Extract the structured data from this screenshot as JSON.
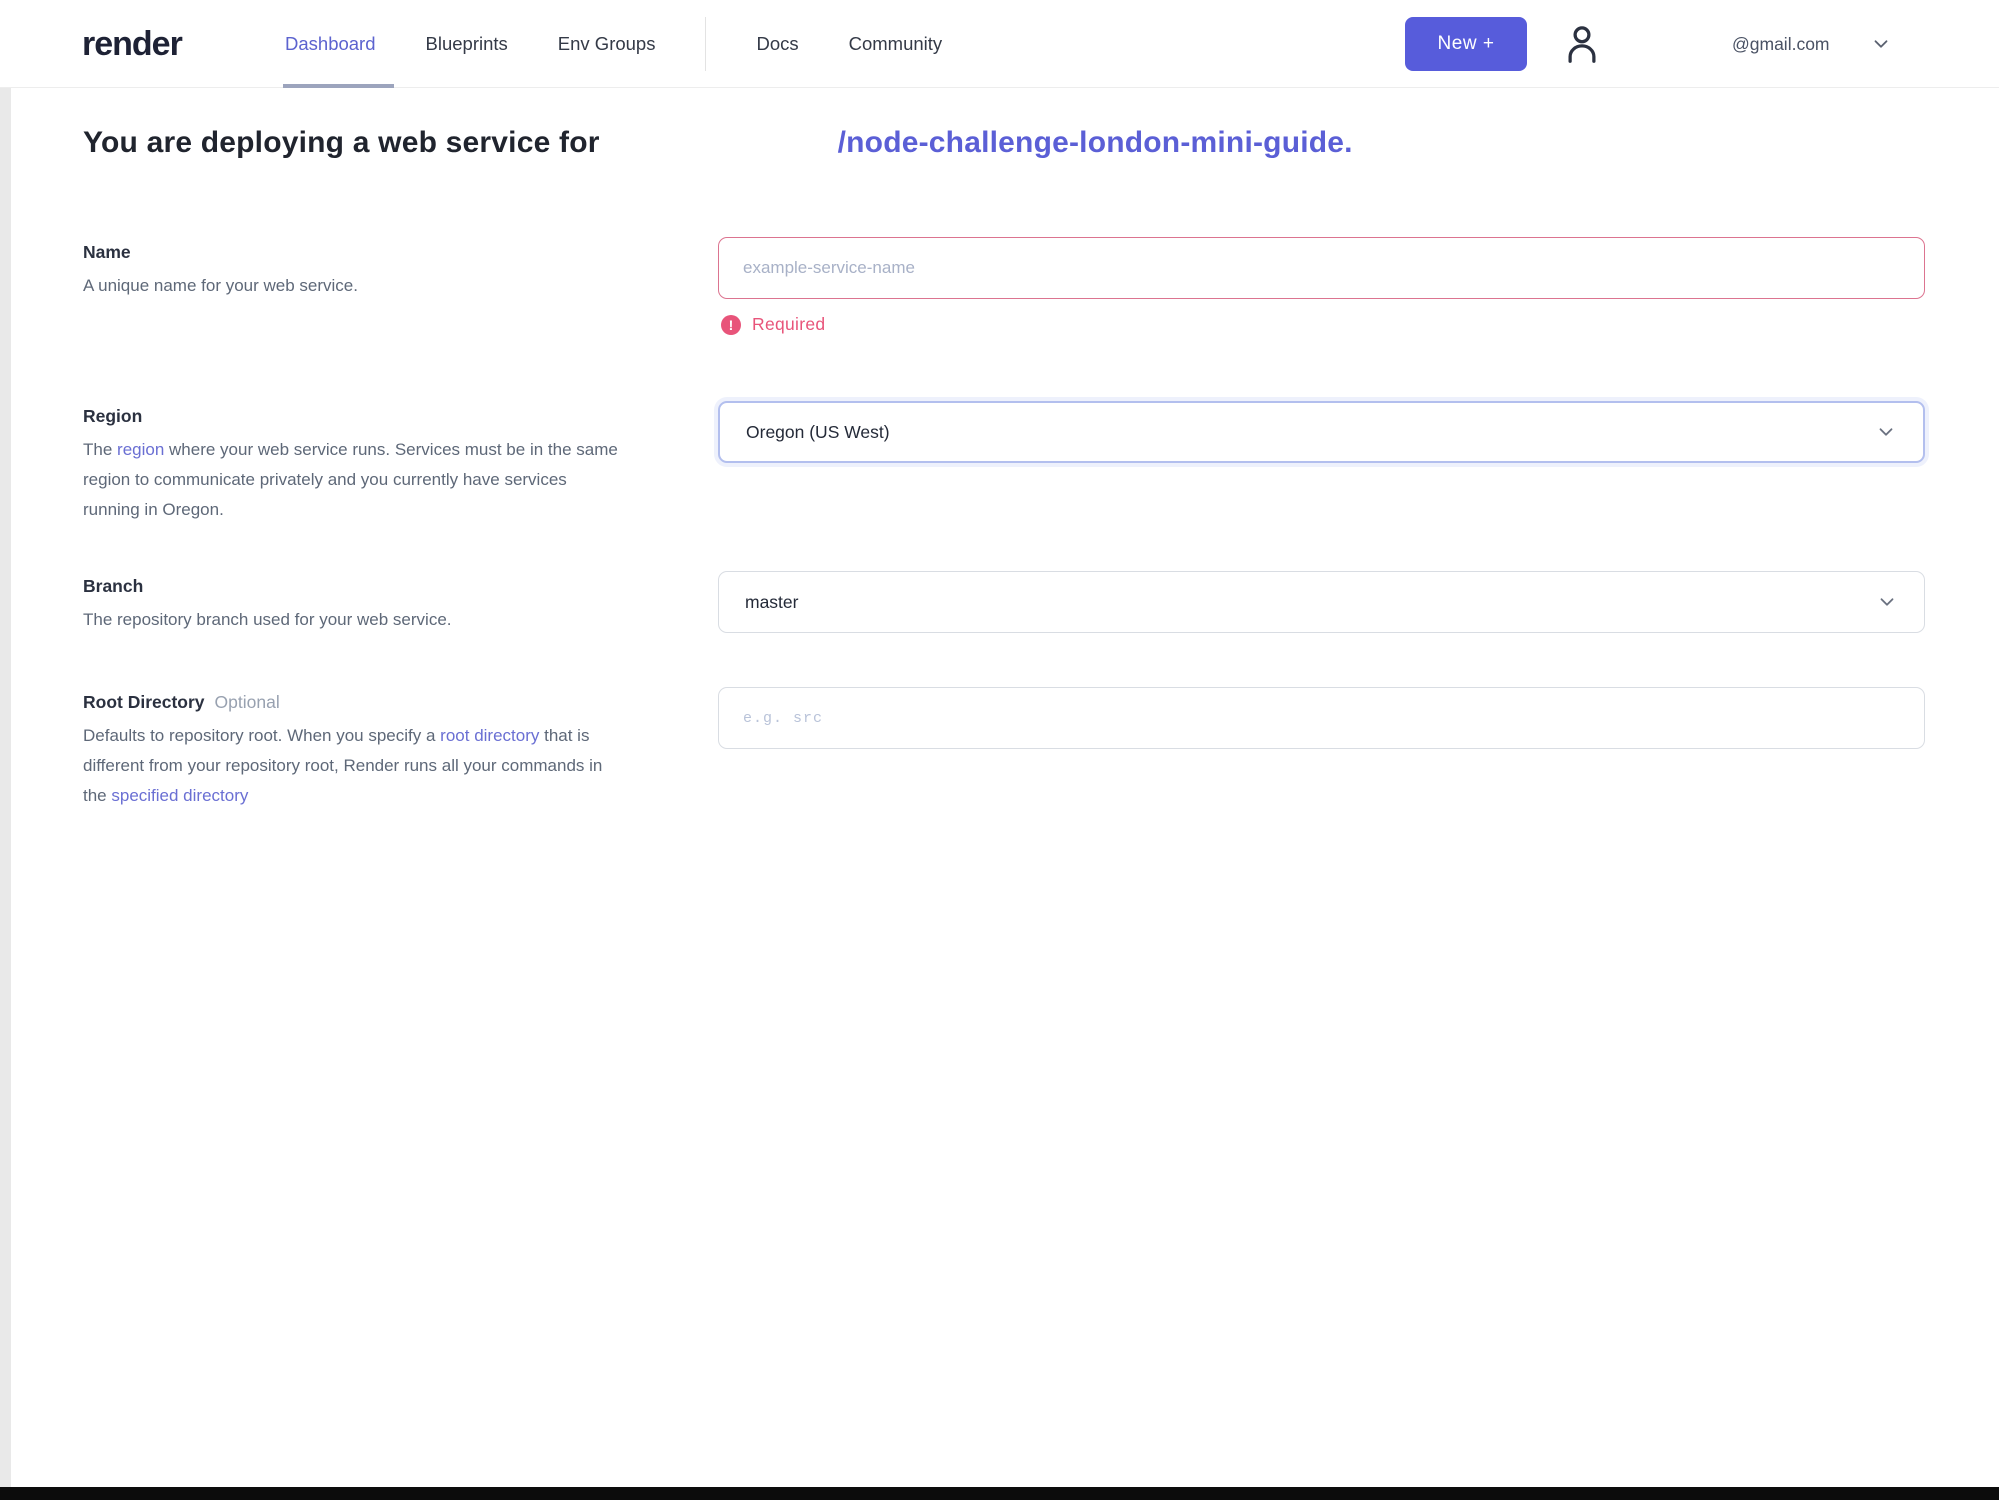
{
  "header": {
    "logo": "render",
    "nav": [
      {
        "label": "Dashboard"
      },
      {
        "label": "Blueprints"
      },
      {
        "label": "Env Groups"
      },
      {
        "label": "Docs"
      },
      {
        "label": "Community"
      }
    ],
    "new_button_label": "New +",
    "account": {
      "email": "@gmail.com"
    }
  },
  "page_title": {
    "prefix": "You are deploying a web service for",
    "repo_link": "/node-challenge-london-mini-guide."
  },
  "form": {
    "name": {
      "label": "Name",
      "description": "A unique name for your web service.",
      "placeholder": "example-service-name",
      "error_icon": "!",
      "error_message": "Required"
    },
    "region": {
      "label": "Region",
      "desc_pre": "The ",
      "desc_link": "region",
      "desc_post": " where your web service runs. Services must be in the same region to communicate privately and you currently have services running in Oregon.",
      "value": "Oregon (US West)"
    },
    "branch": {
      "label": "Branch",
      "description": "The repository branch used for your web service.",
      "value": "master"
    },
    "root_directory": {
      "label": "Root Directory",
      "optional_badge": "Optional",
      "desc_t1": "Defaults to repository root. When you specify a ",
      "desc_link1": "root directory",
      "desc_t2": " that is different from your repository root, Render runs all your commands in the ",
      "desc_link2": "specified directory",
      "placeholder": "e.g. src"
    }
  },
  "colors": {
    "accent_purple": "#575cdb",
    "link_purple": "#5b5fd6",
    "nav_active": "#5c63cf",
    "error_pink": "#e8547a",
    "region_focus_border": "#b3bfee",
    "error_border": "#dc7490"
  }
}
